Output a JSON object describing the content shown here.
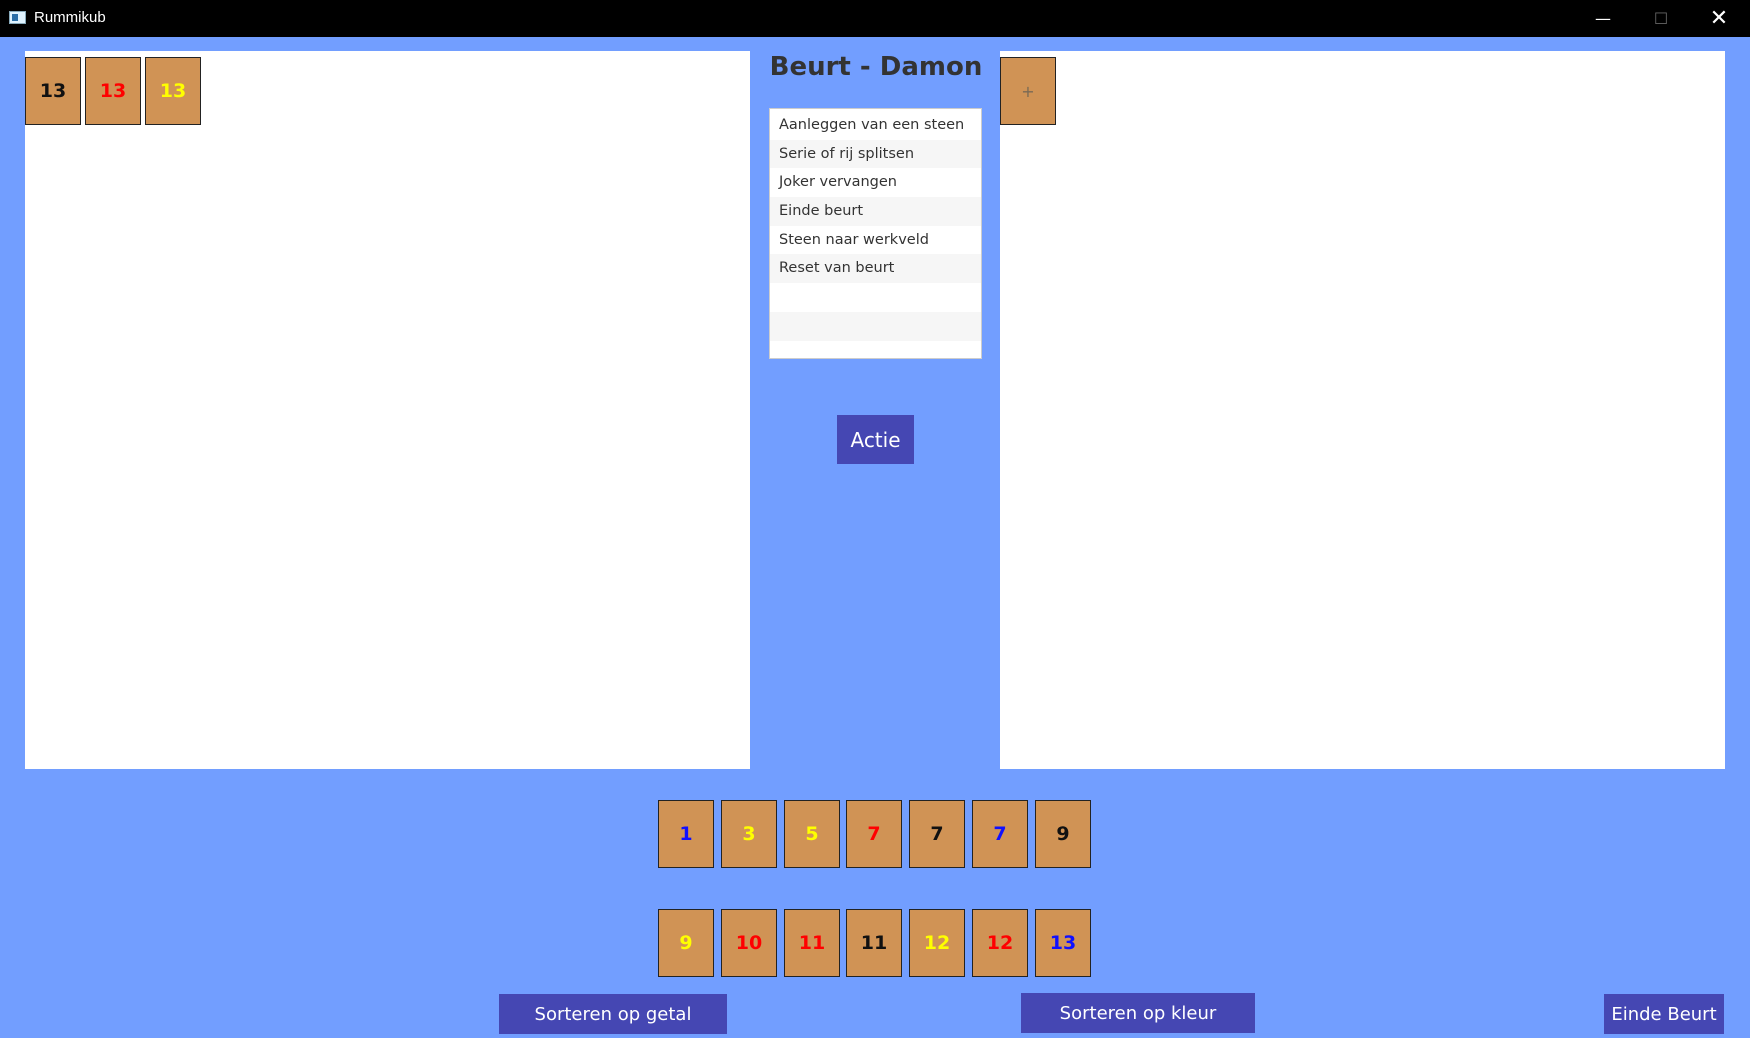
{
  "window": {
    "title": "Rummikub",
    "min_glyph": "—",
    "max_glyph": "☐",
    "close_glyph": "✕",
    "icons": {
      "app": "app-window-icon",
      "min": "minimize-icon",
      "max": "maximize-icon",
      "close": "close-icon"
    }
  },
  "colors": {
    "background": "#729eff",
    "board": "#ffffff",
    "tile": "#d09355",
    "button": "#4547b3",
    "black": "#111111",
    "red": "#ff0000",
    "yellow": "#ffff00",
    "blue": "#1010ff"
  },
  "left_board": {
    "tiles": [
      {
        "number": "13",
        "color": "black"
      },
      {
        "number": "13",
        "color": "red"
      },
      {
        "number": "13",
        "color": "yellow"
      }
    ]
  },
  "right_board": {
    "add_tile": {
      "label": "+",
      "color": "#7a6a55"
    }
  },
  "turn": {
    "title": "Beurt - Damon"
  },
  "actions": {
    "items": [
      "Aanleggen van een steen",
      "Serie of rij splitsen",
      "Joker vervangen",
      "Einde beurt",
      "Steen naar werkveld",
      "Reset van beurt",
      "",
      ""
    ],
    "button_label": "Actie"
  },
  "rack": {
    "row1": [
      {
        "number": "1",
        "color": "blue"
      },
      {
        "number": "3",
        "color": "yellow"
      },
      {
        "number": "5",
        "color": "yellow"
      },
      {
        "number": "7",
        "color": "red"
      },
      {
        "number": "7",
        "color": "black"
      },
      {
        "number": "7",
        "color": "blue"
      },
      {
        "number": "9",
        "color": "black"
      }
    ],
    "row2": [
      {
        "number": "9",
        "color": "yellow"
      },
      {
        "number": "10",
        "color": "red"
      },
      {
        "number": "11",
        "color": "red"
      },
      {
        "number": "11",
        "color": "black"
      },
      {
        "number": "12",
        "color": "yellow"
      },
      {
        "number": "12",
        "color": "red"
      },
      {
        "number": "13",
        "color": "blue"
      }
    ]
  },
  "buttons": {
    "sort_number": "Sorteren op getal",
    "sort_color": "Sorteren op kleur",
    "end_turn": "Einde Beurt"
  }
}
